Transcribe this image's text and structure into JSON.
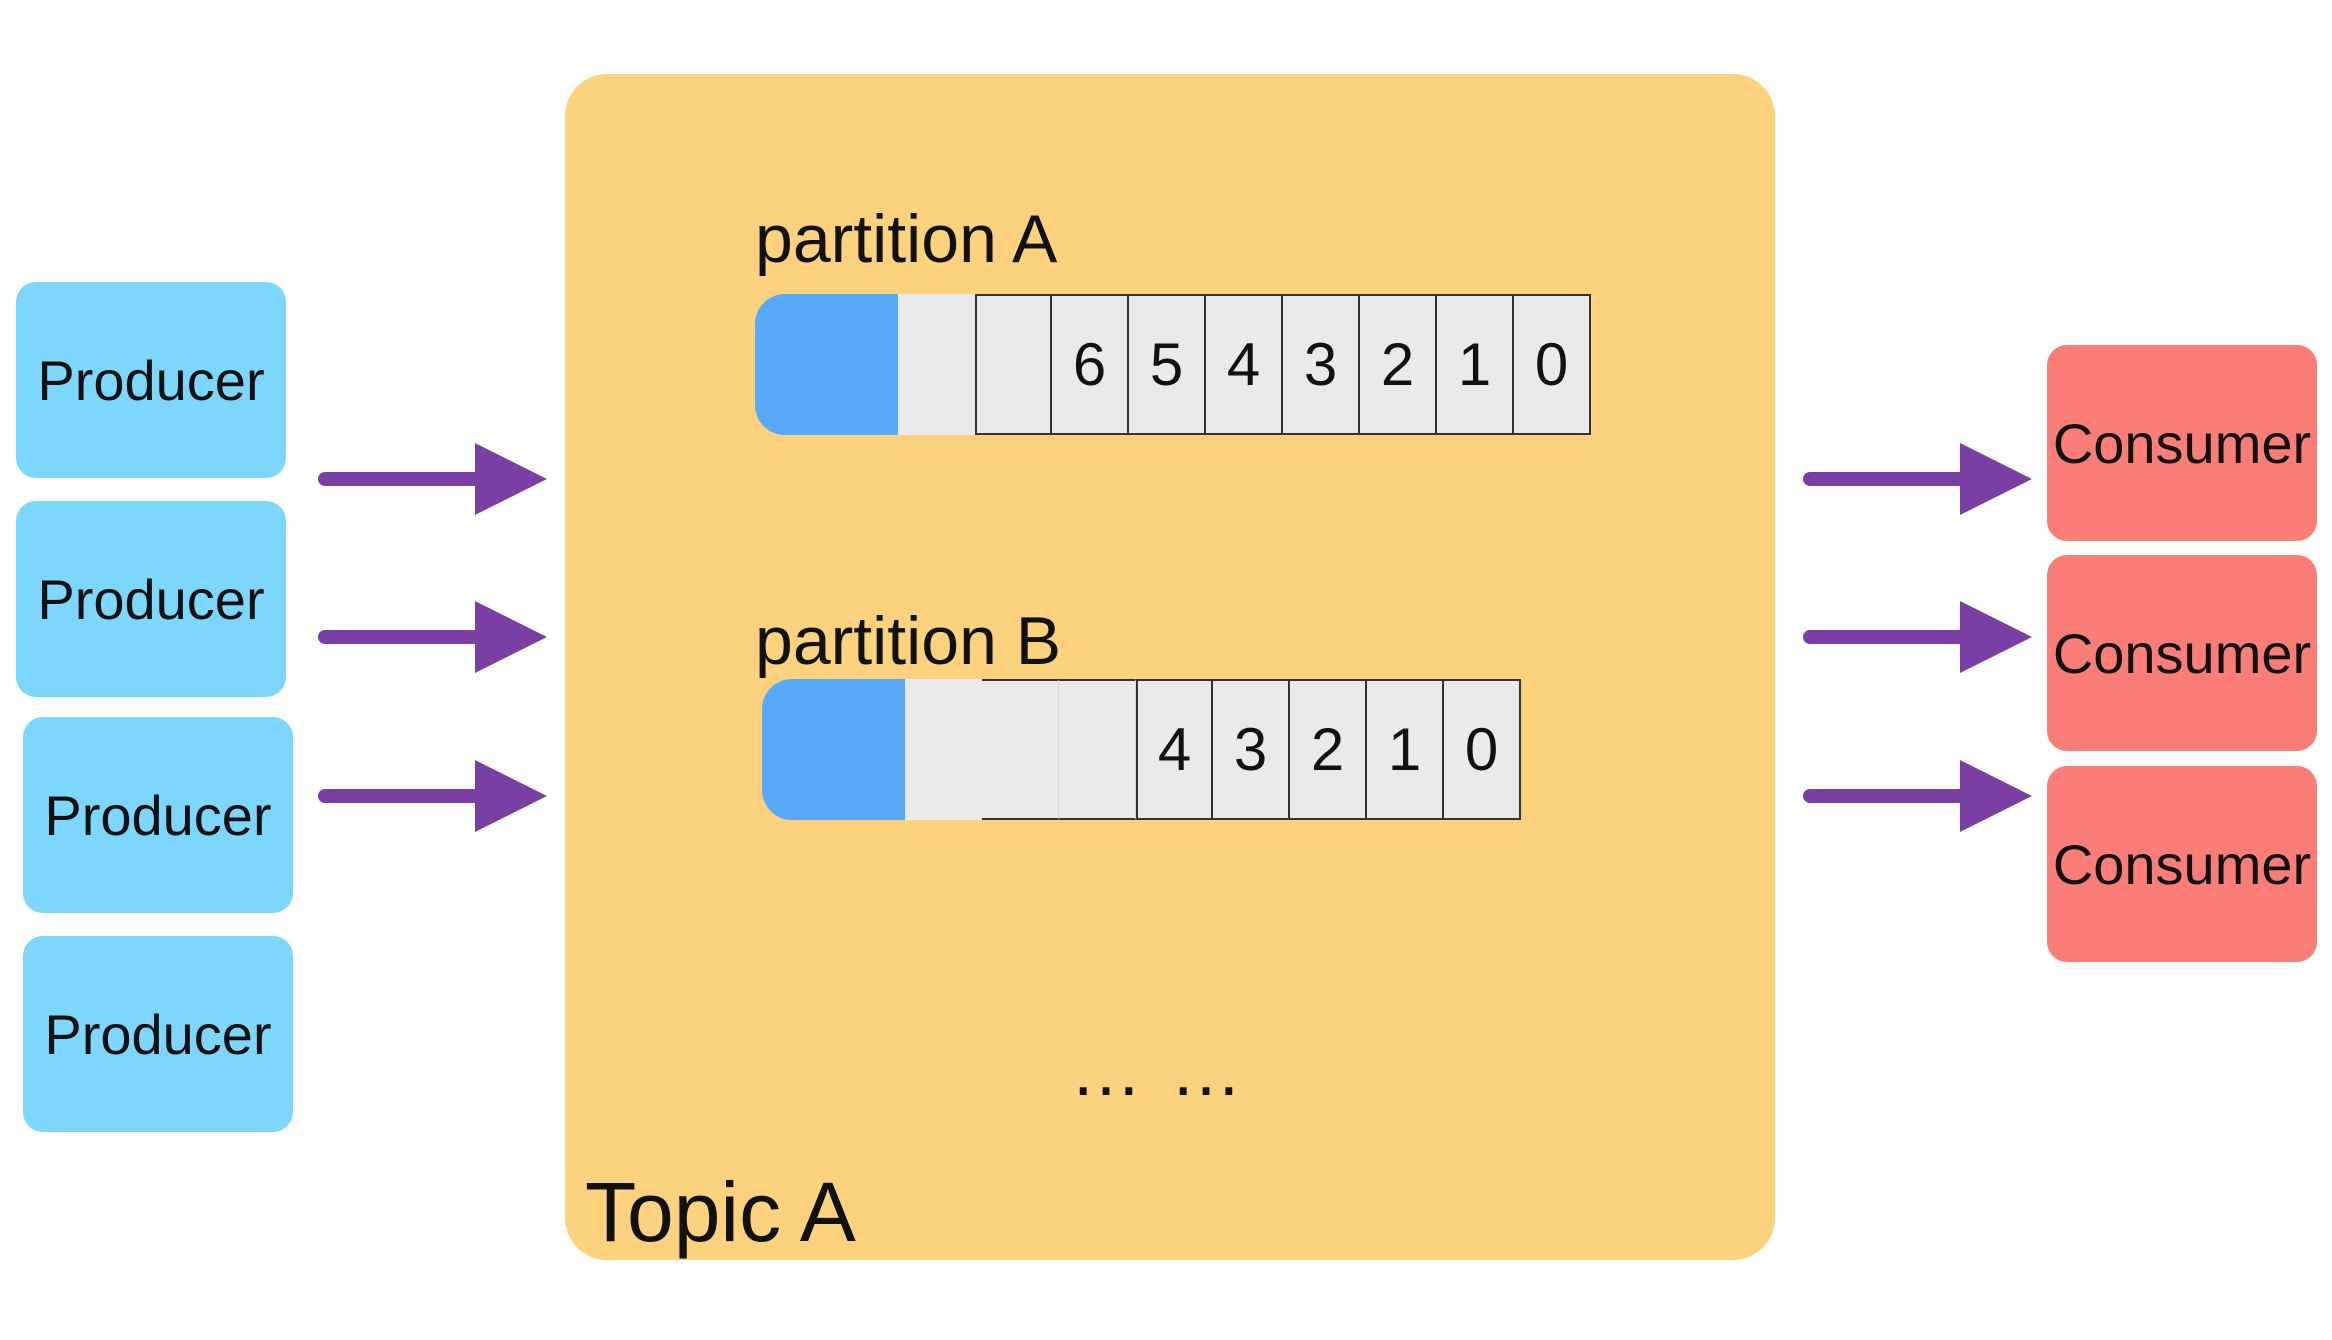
{
  "producers": [
    "Producer",
    "Producer",
    "Producer",
    "Producer"
  ],
  "consumers": [
    "Consumer",
    "Consumer",
    "Consumer"
  ],
  "topic": {
    "label": "Topic A"
  },
  "partitions": [
    {
      "label": "partition A",
      "cells": [
        "6",
        "5",
        "4",
        "3",
        "2",
        "1",
        "0"
      ]
    },
    {
      "label": "partition B",
      "cells": [
        "4",
        "3",
        "2",
        "1",
        "0"
      ]
    }
  ],
  "ellipsis": "… …",
  "colors": {
    "producer": "#7dd6fc",
    "consumer": "#fb7d78",
    "topic": "#fcd27f",
    "arrow": "#7a3fa3",
    "head": "#58a9f7"
  }
}
